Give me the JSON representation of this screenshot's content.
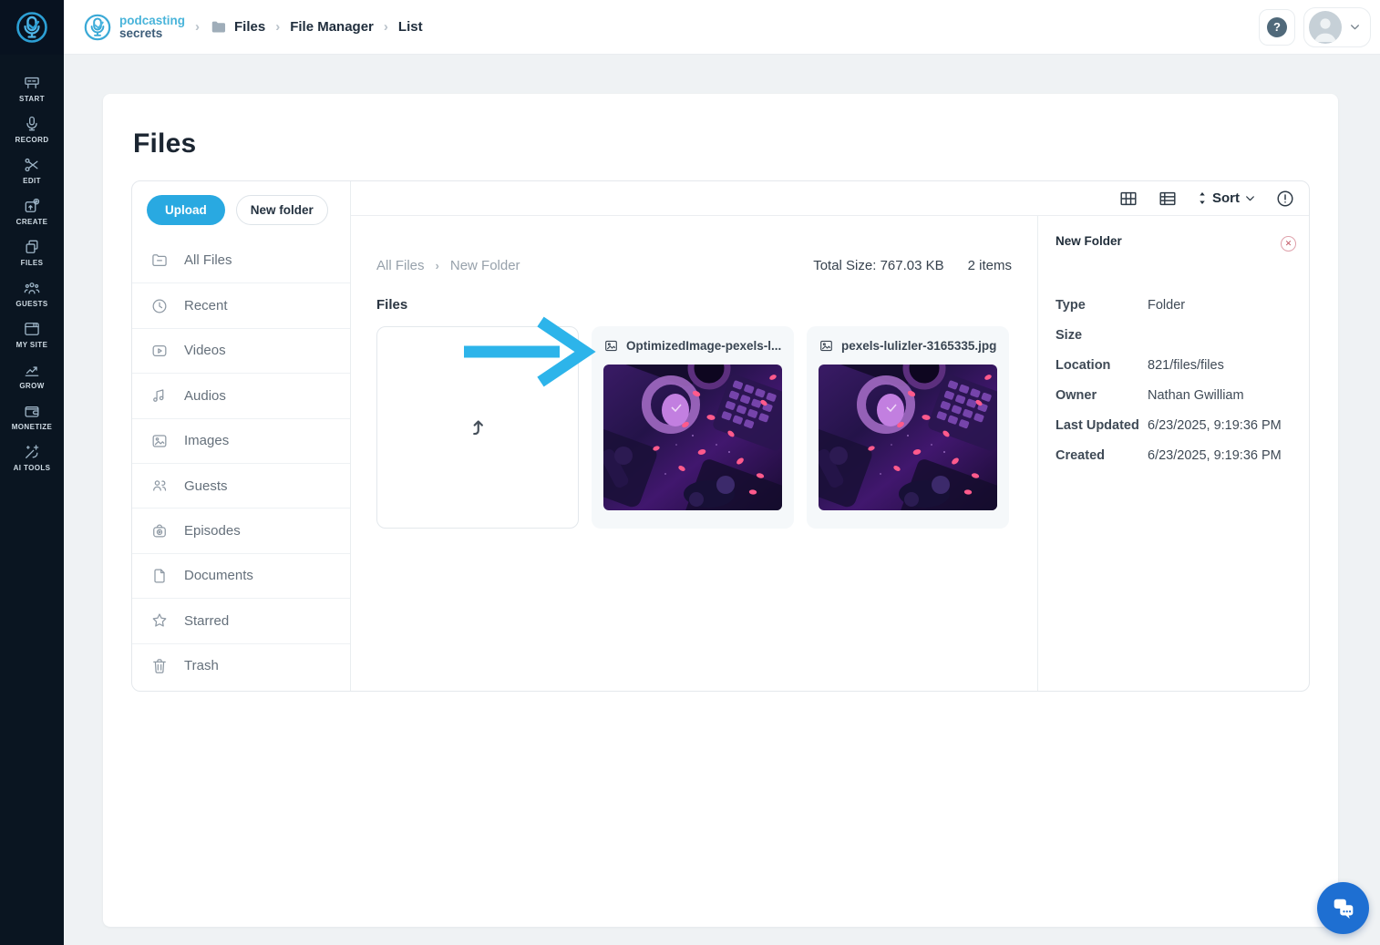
{
  "header": {
    "brand": {
      "line1": "podcasting",
      "line2": "secrets"
    },
    "breadcrumb": {
      "files": "Files",
      "file_manager": "File Manager",
      "list": "List"
    }
  },
  "rail": {
    "items": [
      {
        "label": "START"
      },
      {
        "label": "RECORD"
      },
      {
        "label": "EDIT"
      },
      {
        "label": "CREATE"
      },
      {
        "label": "FILES"
      },
      {
        "label": "GUESTS"
      },
      {
        "label": "MY SITE"
      },
      {
        "label": "GROW"
      },
      {
        "label": "MONETIZE"
      },
      {
        "label": "AI TOOLS"
      }
    ]
  },
  "page": {
    "title": "Files"
  },
  "library": {
    "upload_label": "Upload",
    "new_folder_label": "New folder",
    "items": [
      {
        "label": "All Files"
      },
      {
        "label": "Recent"
      },
      {
        "label": "Videos"
      },
      {
        "label": "Audios"
      },
      {
        "label": "Images"
      },
      {
        "label": "Guests"
      },
      {
        "label": "Episodes"
      },
      {
        "label": "Documents"
      },
      {
        "label": "Starred"
      },
      {
        "label": "Trash"
      }
    ]
  },
  "toolbar": {
    "sort_label": "Sort"
  },
  "files_view": {
    "breadcrumb": {
      "parent": "All Files",
      "current": "New Folder"
    },
    "total_size_label": "Total Size: 767.03 KB",
    "items_count_label": "2 items",
    "section_label": "Files",
    "files": [
      {
        "name": "OptimizedImage-pexels-l..."
      },
      {
        "name": "pexels-lulizler-3165335.jpg"
      }
    ]
  },
  "details": {
    "title": "New Folder",
    "rows": [
      {
        "label": "Type",
        "value": "Folder"
      },
      {
        "label": "Size",
        "value": ""
      },
      {
        "label": "Location",
        "value": "821/files/files"
      },
      {
        "label": "Owner",
        "value": "Nathan Gwilliam"
      },
      {
        "label": "Last Updated",
        "value": "6/23/2025, 9:19:36 PM"
      },
      {
        "label": "Created",
        "value": "6/23/2025, 9:19:36 PM"
      }
    ]
  },
  "colors": {
    "accent": "#29a9e1",
    "annotation_arrow": "#2db4ea",
    "chat_button": "#1e6fd2",
    "sidebar_bg": "#0a1521"
  }
}
